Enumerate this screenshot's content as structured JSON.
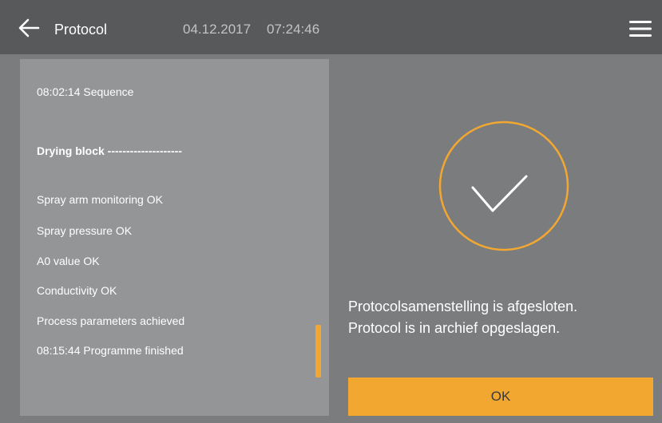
{
  "header": {
    "title": "Protocol",
    "date": "04.12.2017",
    "time": "07:24:46",
    "back_icon": "arrow-left-icon",
    "menu_icon": "hamburger-menu-icon"
  },
  "protocol_log": {
    "lines": [
      "08:02:14 Sequence",
      "Drying block --------------------",
      "Spray arm monitoring OK",
      "Spray pressure OK",
      "A0 value OK",
      "Conductivity OK",
      "Process parameters achieved",
      "08:15:44 Programme finished"
    ]
  },
  "status": {
    "icon": "check-circle-icon",
    "message_line1": "Protocolsamenstelling is afgesloten.",
    "message_line2": "Protocol is in archief opgeslagen."
  },
  "ok_button": {
    "label": "OK"
  },
  "colors": {
    "background": "#7b7c7e",
    "header": "#58595b",
    "panel": "#939597",
    "accent": "#f2a830"
  }
}
